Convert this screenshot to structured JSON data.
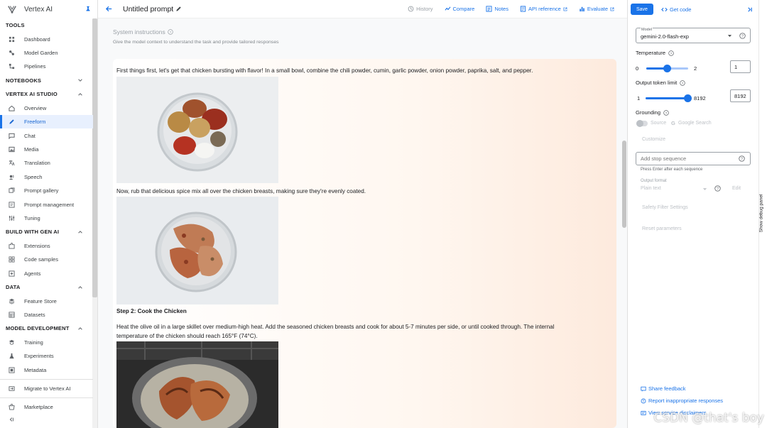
{
  "app": {
    "name": "Vertex AI"
  },
  "sidebar": {
    "groups": [
      {
        "title": "TOOLS",
        "collapsible": false,
        "items": [
          {
            "label": "Dashboard",
            "icon": "dashboard-icon"
          },
          {
            "label": "Model Garden",
            "icon": "model-garden-icon"
          },
          {
            "label": "Pipelines",
            "icon": "pipelines-icon"
          }
        ]
      },
      {
        "title": "NOTEBOOKS",
        "collapsible": true,
        "expanded": false,
        "items": []
      },
      {
        "title": "VERTEX AI STUDIO",
        "collapsible": true,
        "expanded": true,
        "items": [
          {
            "label": "Overview",
            "icon": "home-icon"
          },
          {
            "label": "Freeform",
            "icon": "freeform-icon",
            "active": true
          },
          {
            "label": "Chat",
            "icon": "chat-icon"
          },
          {
            "label": "Media",
            "icon": "media-icon"
          },
          {
            "label": "Translation",
            "icon": "translation-icon"
          },
          {
            "label": "Speech",
            "icon": "speech-icon"
          },
          {
            "label": "Prompt gallery",
            "icon": "prompt-gallery-icon"
          },
          {
            "label": "Prompt management",
            "icon": "prompt-management-icon"
          },
          {
            "label": "Tuning",
            "icon": "tuning-icon"
          }
        ]
      },
      {
        "title": "BUILD WITH GEN AI",
        "collapsible": true,
        "expanded": true,
        "items": [
          {
            "label": "Extensions",
            "icon": "extensions-icon"
          },
          {
            "label": "Code samples",
            "icon": "code-samples-icon"
          },
          {
            "label": "Agents",
            "icon": "agents-icon"
          }
        ]
      },
      {
        "title": "DATA",
        "collapsible": true,
        "expanded": true,
        "items": [
          {
            "label": "Feature Store",
            "icon": "feature-store-icon"
          },
          {
            "label": "Datasets",
            "icon": "datasets-icon"
          }
        ]
      },
      {
        "title": "MODEL DEVELOPMENT",
        "collapsible": true,
        "expanded": true,
        "items": [
          {
            "label": "Training",
            "icon": "training-icon"
          },
          {
            "label": "Experiments",
            "icon": "experiments-icon"
          },
          {
            "label": "Metadata",
            "icon": "metadata-icon"
          }
        ]
      }
    ],
    "footer_items": [
      {
        "label": "Migrate to Vertex AI",
        "icon": "migrate-icon"
      },
      {
        "label": "Marketplace",
        "icon": "marketplace-icon"
      }
    ]
  },
  "topbar": {
    "title": "Untitled prompt",
    "actions": [
      {
        "label": "History",
        "icon": "history-icon",
        "disabled": true
      },
      {
        "label": "Compare",
        "icon": "compare-icon"
      },
      {
        "label": "Notes",
        "icon": "notes-icon"
      },
      {
        "label": "API reference",
        "icon": "api-reference-icon",
        "external": true
      },
      {
        "label": "Evaluate",
        "icon": "evaluate-icon",
        "external": true
      }
    ]
  },
  "system_instructions": {
    "label": "System instructions",
    "hint": "Give the model context to understand the task and provide tailored responses"
  },
  "response": {
    "step1_text": "First things first, let's get that chicken bursting with flavor! In a small bowl, combine the chili powder, cumin, garlic powder, onion powder, paprika, salt, and pepper.",
    "step1b_text": "Now, rub that delicious spice mix all over the chicken breasts, making sure they're evenly coated.",
    "step2_heading": "Step 2: Cook the Chicken",
    "step2_text_line1": "Heat the olive oil in a large skillet over medium-high heat. Add the seasoned chicken breasts and cook for about 5-7 minutes per side, or until cooked through. The internal",
    "step2_text_line2": "temperature of the chicken should reach 165°F (74°C)."
  },
  "panel": {
    "save_label": "Save",
    "get_code_label": "Get code",
    "model_field_label": "Model",
    "model_value": "gemini-2.0-flash-exp",
    "temperature": {
      "label": "Temperature",
      "min": "0",
      "max": "2",
      "value": "1",
      "fraction": 0.5
    },
    "output_token_limit": {
      "label": "Output token limit",
      "min": "1",
      "max": "8192",
      "value": "8192",
      "fraction": 1.0
    },
    "grounding": {
      "label": "Grounding",
      "source_label": "Source",
      "google_search_label": "Google Search",
      "customize_label": "Customize"
    },
    "stop_sequence": {
      "placeholder": "Add stop sequence",
      "hint": "Press Enter after each sequence"
    },
    "output_format": {
      "label": "Output format",
      "value": "Plain text",
      "edit_label": "Edit"
    },
    "safety_label": "Safety Filter Settings",
    "reset_label": "Reset parameters",
    "footer_links": [
      {
        "label": "Share feedback",
        "icon": "feedback-icon"
      },
      {
        "label": "Report inappropriate responses",
        "icon": "report-icon"
      },
      {
        "label": "View service disclaimers",
        "icon": "disclaimer-icon"
      }
    ]
  },
  "debug_tab_label": "Show debug panel",
  "watermark": "CSDN @that's boy",
  "colors": {
    "accent": "#1a73e8",
    "active_bg": "#e8f0fe",
    "response_gradient_end": "#fdeadd"
  }
}
